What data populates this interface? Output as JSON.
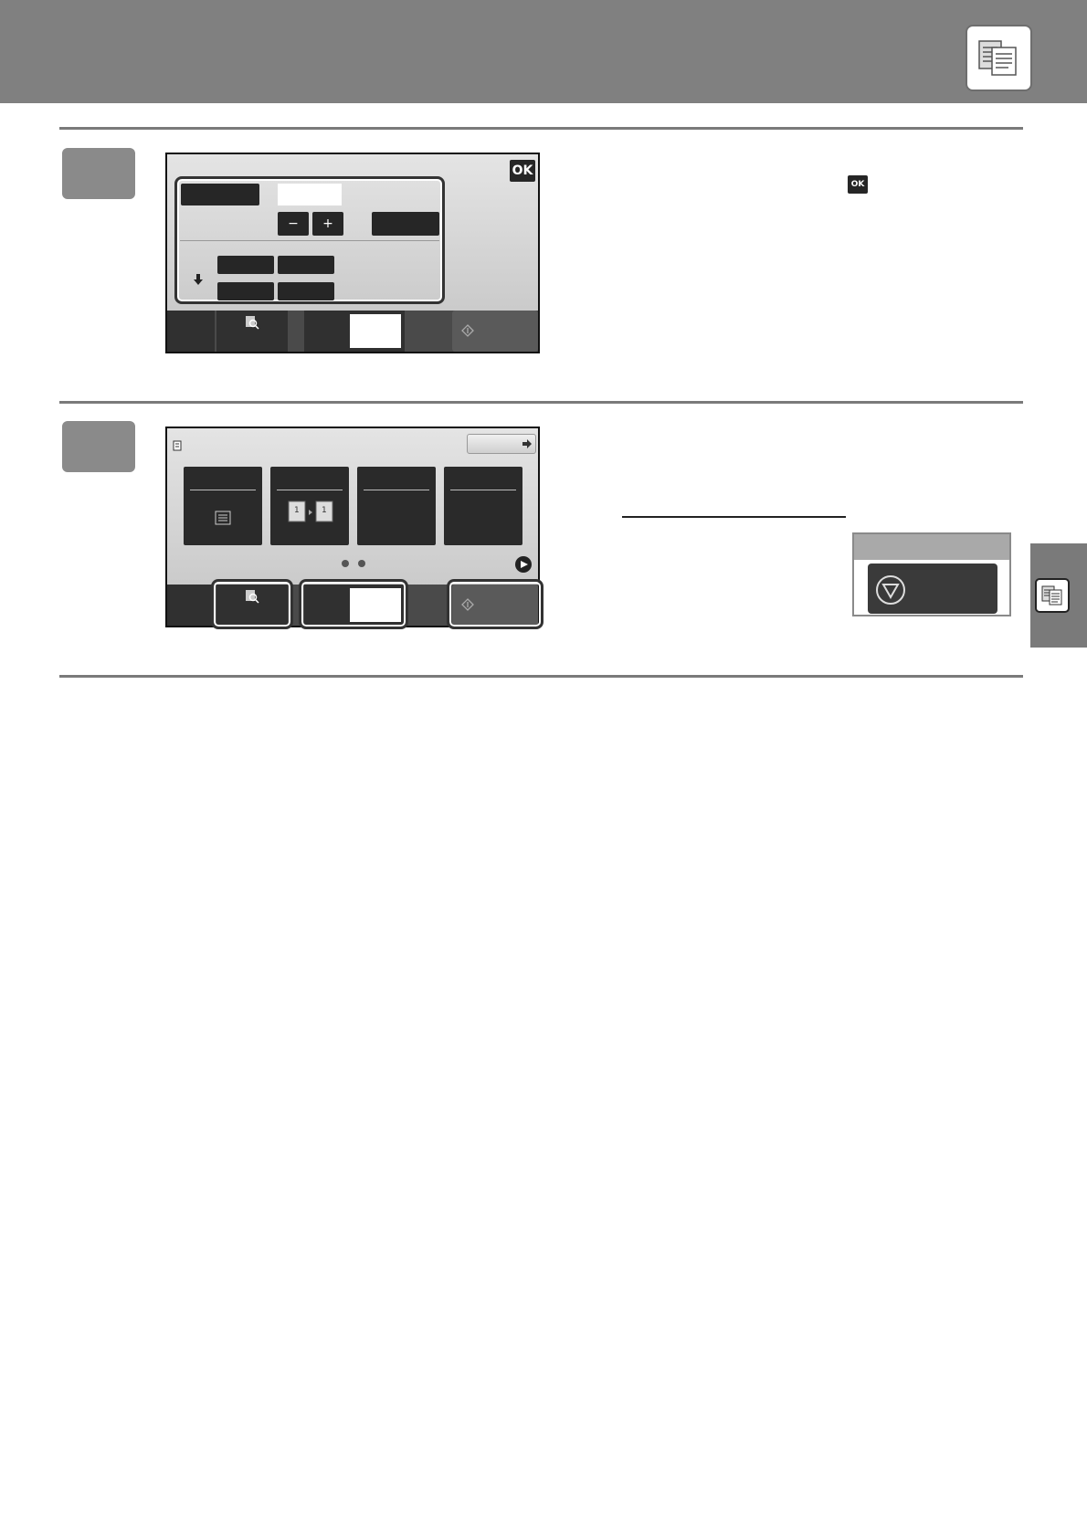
{
  "header": {
    "icon": "copy-documents-icon"
  },
  "step3": {
    "screen": {
      "ok_label": "OK",
      "minus_label": "−",
      "plus_label": "+",
      "arrow_icon": "down-arrow-icon",
      "preview_icon": "preview-magnifier-icon",
      "start_icon": "start-diamond-icon"
    },
    "inline_ok_label": "OK"
  },
  "step4": {
    "screen": {
      "top_left_icon": "document-icon",
      "next_arrow_icon": "right-arrow-icon",
      "tile2_icon": "duplex-copy-icon",
      "tile1_icon": "document-lines-icon",
      "page_dots": 2,
      "next_page_icon": "play-circle-icon",
      "preview_icon": "preview-magnifier-icon",
      "start_icon": "start-diamond-icon"
    },
    "stop_panel": {
      "stop_icon": "stop-triangle-icon"
    }
  },
  "side_tab": {
    "icon": "copy-documents-icon"
  }
}
